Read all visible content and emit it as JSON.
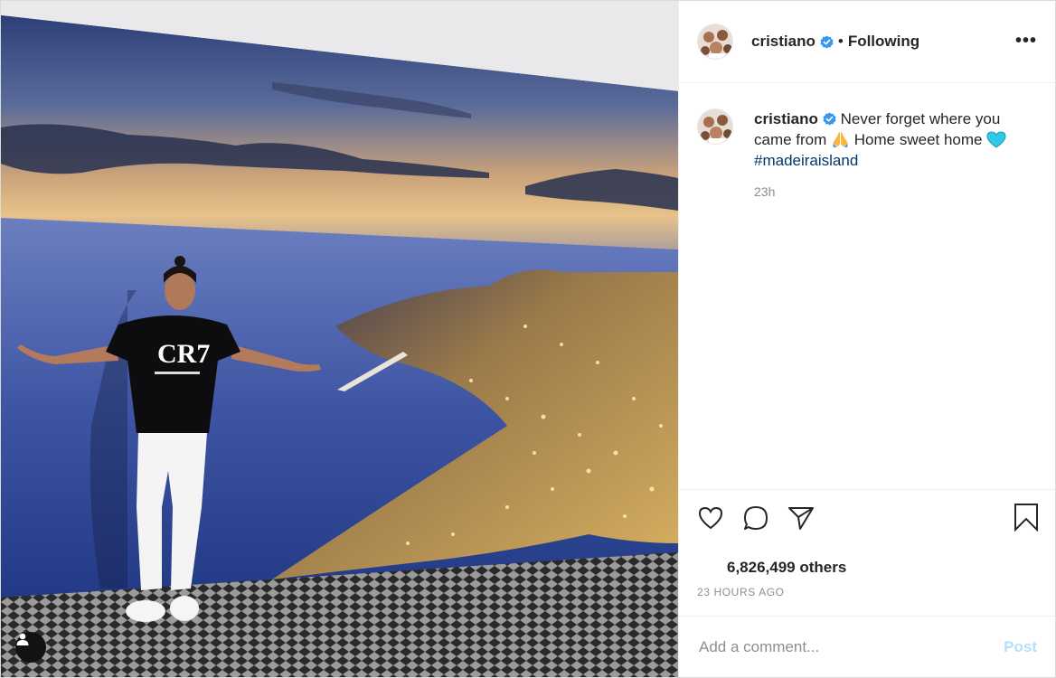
{
  "post": {
    "author": "cristiano",
    "follow_separator": "•",
    "follow_status": "Following",
    "more_icon": "more-horizontal-icon",
    "more_label": "•••",
    "caption": {
      "username": "cristiano",
      "text_part1": "Never forget where you came from",
      "text_part2": "Home sweet home",
      "hashtag": "#madeiraisland",
      "emoji_1": "folded-hands",
      "emoji_2": "blue-heart"
    },
    "caption_age": "23h",
    "likes_text": "6,826,499 others",
    "timestamp": "23 HOURS AGO"
  },
  "actions": {
    "like_icon": "heart-icon",
    "comment_icon": "comment-icon",
    "share_icon": "paper-plane-icon",
    "save_icon": "bookmark-icon"
  },
  "comment": {
    "placeholder": "Add a comment...",
    "value": "",
    "post_label": "Post"
  },
  "colors": {
    "verified_blue": "#3897f0",
    "hashtag": "#00376b",
    "muted_text": "#8e8e8e",
    "post_button_disabled": "#b2dffc",
    "heart_emoji": "#31c8e8",
    "pray_emoji": "#f6b73c"
  }
}
